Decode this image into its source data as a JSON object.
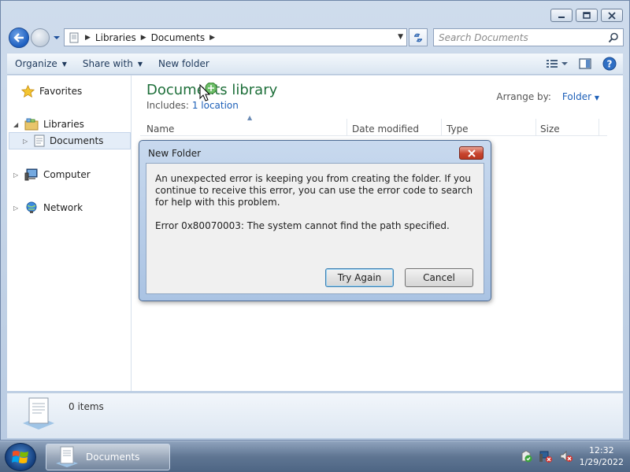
{
  "window": {
    "address": {
      "crumbs": [
        "Libraries",
        "Documents"
      ]
    },
    "search": {
      "placeholder": "Search Documents"
    },
    "toolbar": {
      "organize": "Organize",
      "share_with": "Share with",
      "new_folder": "New folder"
    },
    "nav": {
      "favorites": "Favorites",
      "libraries": "Libraries",
      "documents": "Documents",
      "computer": "Computer",
      "network": "Network"
    },
    "library": {
      "title": "Documents library",
      "includes_label": "Includes:",
      "includes_link": "1 location",
      "arrange_label": "Arrange by:",
      "arrange_value": "Folder"
    },
    "columns": [
      "Name",
      "Date modified",
      "Type",
      "Size"
    ],
    "details": {
      "count": "0 items"
    }
  },
  "dialog": {
    "title": "New Folder",
    "message": "An unexpected error is keeping you from creating the folder. If you continue to receive this error, you can use the error code to search for help with this problem.",
    "error": "Error 0x80070003: The system cannot find the path specified.",
    "try_again": "Try Again",
    "cancel": "Cancel"
  },
  "taskbar": {
    "task_label": "Documents",
    "time": "12:32",
    "date": "1/29/2022"
  },
  "icons": [
    "back-arrow-icon",
    "forward-arrow-icon",
    "refresh-icon",
    "search-icon",
    "star-icon",
    "library-icon",
    "document-icon",
    "computer-icon",
    "network-icon",
    "close-icon",
    "minimize-icon",
    "maximize-icon",
    "help-icon",
    "views-icon",
    "preview-pane-icon",
    "windows-logo-icon",
    "action-center-icon",
    "network-tray-icon",
    "volume-muted-icon"
  ]
}
